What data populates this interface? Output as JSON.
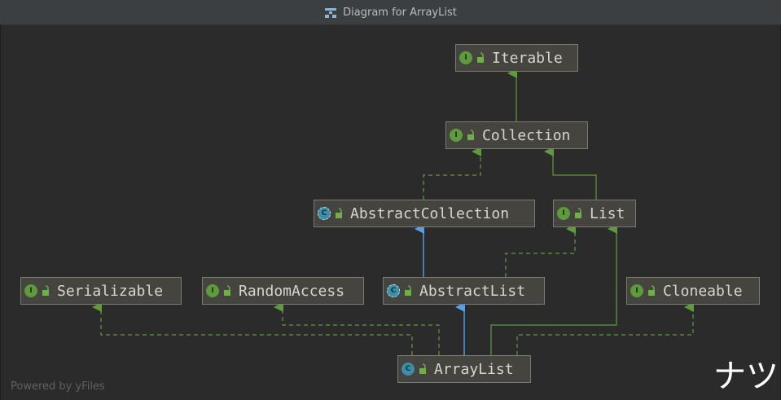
{
  "window": {
    "title": "Diagram for ArrayList",
    "icon": "diagram-icon"
  },
  "colors": {
    "background": "#2b2b2b",
    "node_fill": "#45443e",
    "node_border": "#7a7a74",
    "interface_badge": "#5e9b3c",
    "class_badge": "#3d8ea8",
    "implements_edge": "#5e9b3c",
    "extends_edge": "#5a9ee6"
  },
  "nodes": [
    {
      "id": "iterable",
      "label": "Iterable",
      "kind": "interface",
      "icon": "interface-icon"
    },
    {
      "id": "collection",
      "label": "Collection",
      "kind": "interface",
      "icon": "interface-icon"
    },
    {
      "id": "abstractcollection",
      "label": "AbstractCollection",
      "kind": "abstract",
      "icon": "abstract-class-icon"
    },
    {
      "id": "list",
      "label": "List",
      "kind": "interface",
      "icon": "interface-icon"
    },
    {
      "id": "serializable",
      "label": "Serializable",
      "kind": "interface",
      "icon": "interface-icon"
    },
    {
      "id": "randomaccess",
      "label": "RandomAccess",
      "kind": "interface",
      "icon": "interface-icon"
    },
    {
      "id": "abstractlist",
      "label": "AbstractList",
      "kind": "abstract",
      "icon": "abstract-class-icon"
    },
    {
      "id": "cloneable",
      "label": "Cloneable",
      "kind": "interface",
      "icon": "interface-icon"
    },
    {
      "id": "arraylist",
      "label": "ArrayList",
      "kind": "class",
      "icon": "class-icon"
    }
  ],
  "badge_letters": {
    "interface": "I",
    "abstract": "C",
    "class": "C"
  },
  "edges": [
    {
      "from": "collection",
      "to": "iterable",
      "style": "solid",
      "relation": "extends-interface"
    },
    {
      "from": "abstractcollection",
      "to": "collection",
      "style": "dashed",
      "relation": "implements"
    },
    {
      "from": "list",
      "to": "collection",
      "style": "solid",
      "relation": "extends-interface"
    },
    {
      "from": "abstractlist",
      "to": "abstractcollection",
      "style": "solid-blue",
      "relation": "extends"
    },
    {
      "from": "abstractlist",
      "to": "list",
      "style": "dashed",
      "relation": "implements"
    },
    {
      "from": "arraylist",
      "to": "abstractlist",
      "style": "solid-blue",
      "relation": "extends"
    },
    {
      "from": "arraylist",
      "to": "list",
      "style": "solid",
      "relation": "implements"
    },
    {
      "from": "arraylist",
      "to": "serializable",
      "style": "dashed",
      "relation": "implements"
    },
    {
      "from": "arraylist",
      "to": "randomaccess",
      "style": "dashed",
      "relation": "implements"
    },
    {
      "from": "arraylist",
      "to": "cloneable",
      "style": "dashed",
      "relation": "implements"
    }
  ],
  "footer": {
    "powered_by": "Powered by yFiles"
  },
  "overlay": {
    "text": "ナツ"
  }
}
